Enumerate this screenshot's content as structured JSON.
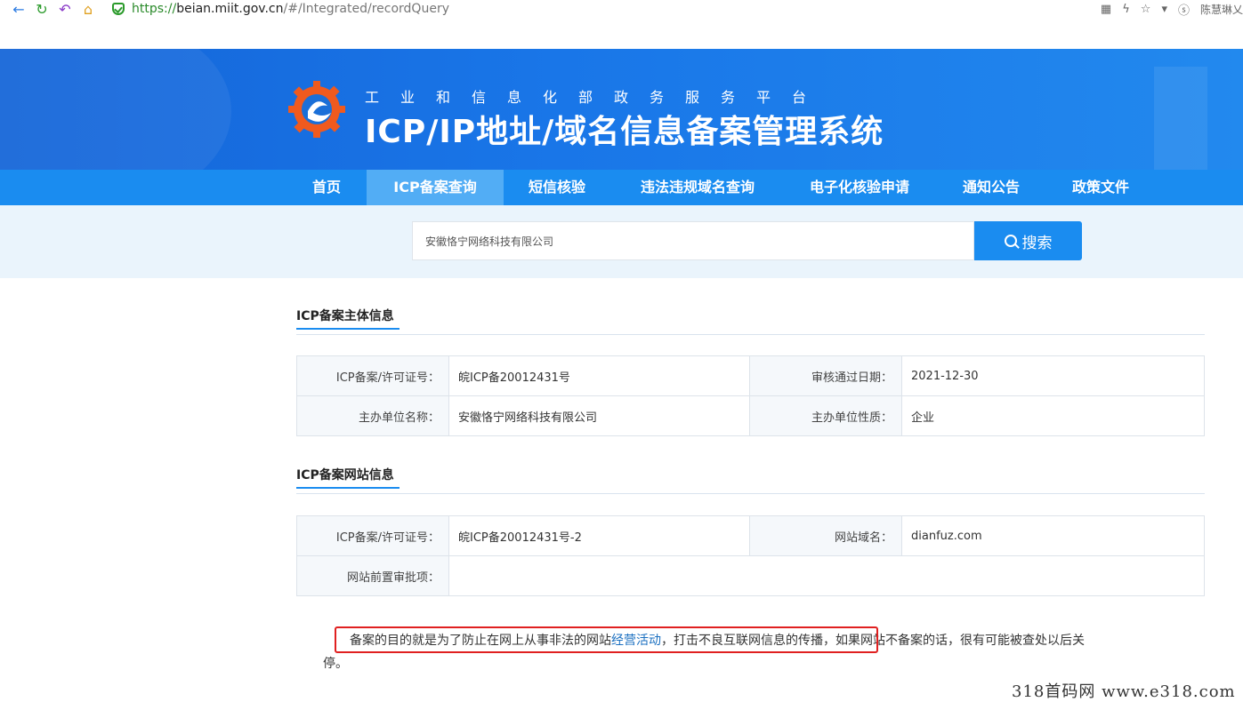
{
  "browser": {
    "url_scheme": "https://",
    "url_host": "beian.miit.gov.cn",
    "url_path": "/#/Integrated/recordQuery",
    "user": "陈慧琳乂"
  },
  "header": {
    "subtitle": "工业和信息化部政务服务平台",
    "title": "ICP/IP地址/域名信息备案管理系统"
  },
  "menu": {
    "items": [
      "首页",
      "ICP备案查询",
      "短信核验",
      "违法违规域名查询",
      "电子化核验申请",
      "通知公告",
      "政策文件"
    ],
    "active_index": 1
  },
  "search": {
    "value": "安徽恪宁网络科技有限公司",
    "button_label": "搜索"
  },
  "subject_info": {
    "title": "ICP备案主体信息",
    "rows": [
      {
        "label1": "ICP备案/许可证号：",
        "value1": "皖ICP备20012431号",
        "label2": "审核通过日期：",
        "value2": "2021-12-30"
      },
      {
        "label1": "主办单位名称：",
        "value1": "安徽恪宁网络科技有限公司",
        "label2": "主办单位性质：",
        "value2": "企业"
      }
    ]
  },
  "site_info": {
    "title": "ICP备案网站信息",
    "row1": {
      "label1": "ICP备案/许可证号：",
      "value1": "皖ICP备20012431号-2",
      "label2": "网站域名：",
      "value2": "dianfuz.com"
    },
    "row2": {
      "label1": "网站前置审批项：",
      "value1": ""
    }
  },
  "note": {
    "part1": "备案的目的就是为了防止在网上从事非法的网站",
    "highlight": "经营活动",
    "part2": "，打击不良互联网信息的传播，如果网站不备案的话，很有可能被查处以后关停。"
  },
  "watermark": "318首码网  www.e318.com"
}
